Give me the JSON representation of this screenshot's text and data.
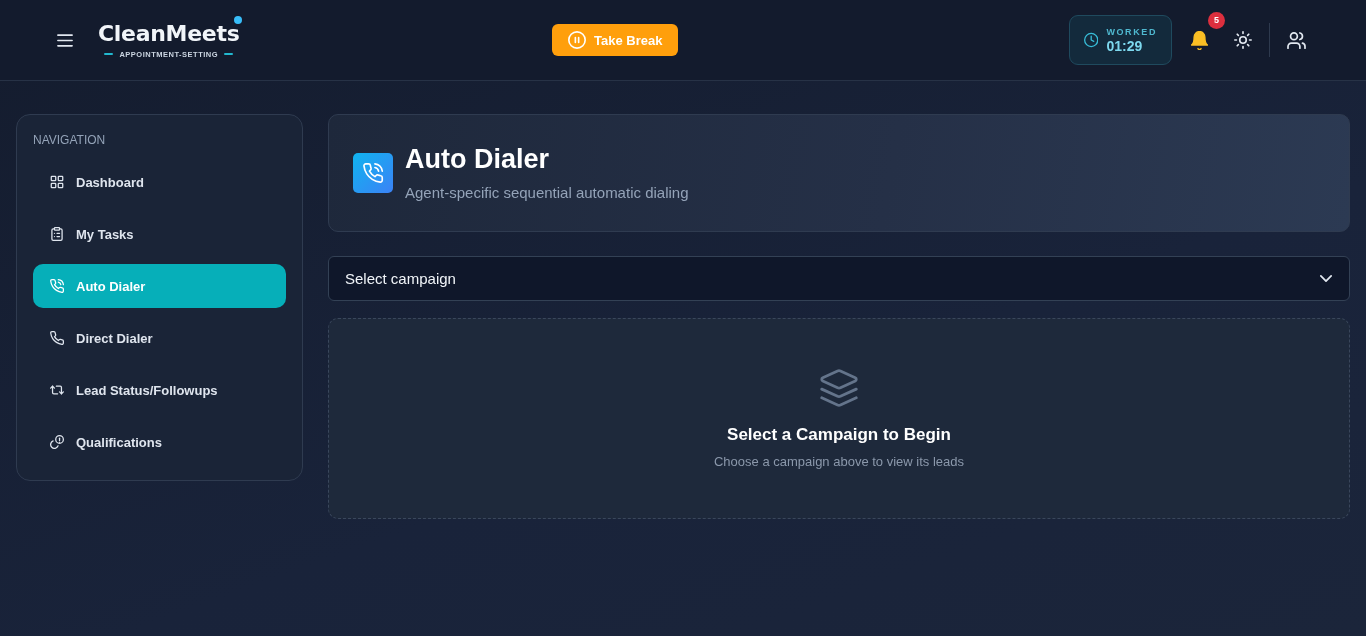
{
  "header": {
    "brand": {
      "name": "CleanMeets",
      "tagline": "APPOINTMENT-SETTING"
    },
    "break_button": {
      "label": "Take Break"
    },
    "worked": {
      "label": "WORKED",
      "time": "01:29"
    },
    "notifications": {
      "count": "5"
    }
  },
  "sidebar": {
    "heading": "NAVIGATION",
    "items": [
      {
        "label": "Dashboard",
        "selected": false
      },
      {
        "label": "My Tasks",
        "selected": false
      },
      {
        "label": "Auto Dialer",
        "selected": true
      },
      {
        "label": "Direct Dialer",
        "selected": false
      },
      {
        "label": "Lead Status/Followups",
        "selected": false
      },
      {
        "label": "Qualifications",
        "selected": false
      }
    ]
  },
  "page_header": {
    "title": "Auto Dialer",
    "subtitle": "Agent-specific sequential automatic dialing"
  },
  "campaign_select": {
    "placeholder": "Select campaign"
  },
  "empty_state": {
    "title": "Select a Campaign to Begin",
    "message": "Choose a campaign above to view its leads"
  }
}
